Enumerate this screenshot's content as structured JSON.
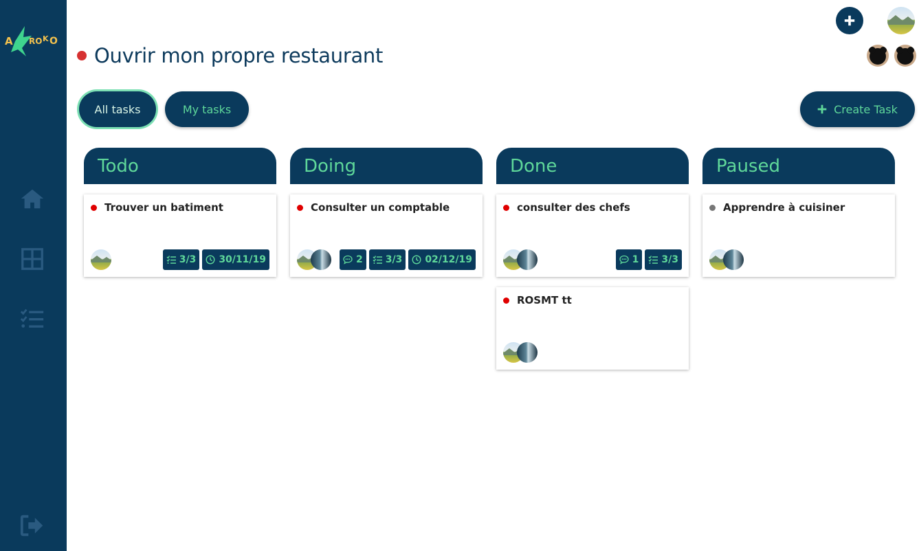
{
  "app": {
    "logo_text": "AKROKO",
    "colors": {
      "sidebar": "#0a3a5c",
      "accent": "#5fd89a",
      "priority_high": "#e00000",
      "priority_none": "#777777"
    }
  },
  "sidebar": {
    "items": [
      {
        "icon": "home-icon"
      },
      {
        "icon": "dashboard-grid-icon"
      },
      {
        "icon": "task-list-icon"
      },
      {
        "icon": "logout-icon"
      }
    ]
  },
  "header": {
    "project_title": "Ouvrir mon propre restaurant",
    "add_icon": "plus-icon"
  },
  "filters": {
    "all_tasks": "All tasks",
    "my_tasks": "My tasks",
    "create_task": "Create Task"
  },
  "board": {
    "columns": [
      {
        "title": "Todo",
        "cards": [
          {
            "title": "Trouver un batiment",
            "priority": "high",
            "checklist": "3/3",
            "due": "30/11/19"
          }
        ]
      },
      {
        "title": "Doing",
        "cards": [
          {
            "title": "Consulter un comptable",
            "priority": "high",
            "comments": "2",
            "checklist": "3/3",
            "due": "02/12/19"
          }
        ]
      },
      {
        "title": "Done",
        "cards": [
          {
            "title": "consulter des chefs",
            "priority": "high",
            "comments": "1",
            "checklist": "3/3"
          },
          {
            "title": "ROSMT tt",
            "priority": "high"
          }
        ]
      },
      {
        "title": "Paused",
        "cards": [
          {
            "title": "Apprendre à cuisiner",
            "priority": "none"
          }
        ]
      }
    ]
  }
}
